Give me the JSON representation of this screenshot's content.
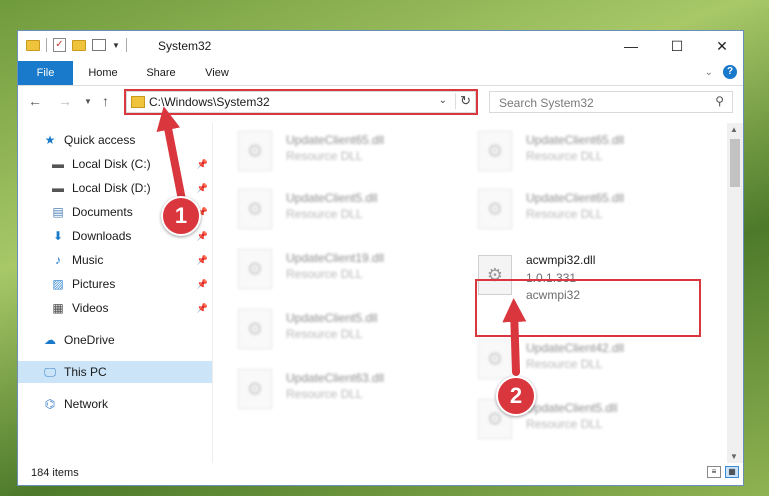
{
  "window": {
    "title": "System32",
    "controls": {
      "minimize": "—",
      "maximize": "☐",
      "close": "✕"
    }
  },
  "ribbon": {
    "tabs": [
      {
        "label": "File"
      },
      {
        "label": "Home"
      },
      {
        "label": "Share"
      },
      {
        "label": "View"
      }
    ],
    "help": "?"
  },
  "address_bar": {
    "path": "C:\\Windows\\System32",
    "refresh_icon": "refresh-icon"
  },
  "search": {
    "placeholder": "Search System32"
  },
  "sidebar": {
    "items": [
      {
        "label": "Quick access",
        "icon": "star-icon",
        "pinned": false
      },
      {
        "label": "Local Disk (C:)",
        "icon": "drive-icon",
        "pinned": true
      },
      {
        "label": "Local Disk (D:)",
        "icon": "drive-icon",
        "pinned": true
      },
      {
        "label": "Documents",
        "icon": "document-icon",
        "pinned": true
      },
      {
        "label": "Downloads",
        "icon": "download-icon",
        "pinned": true
      },
      {
        "label": "Music",
        "icon": "music-icon",
        "pinned": true
      },
      {
        "label": "Pictures",
        "icon": "pictures-icon",
        "pinned": true
      },
      {
        "label": "Videos",
        "icon": "video-icon",
        "pinned": true
      },
      {
        "label": "OneDrive",
        "icon": "cloud-icon",
        "pinned": false
      },
      {
        "label": "This PC",
        "icon": "computer-icon",
        "pinned": false,
        "selected": true
      },
      {
        "label": "Network",
        "icon": "network-icon",
        "pinned": false
      }
    ]
  },
  "files": {
    "left": [
      {
        "name": "UpdateClient65.dll",
        "type": "Resource DLL"
      },
      {
        "name": "UpdateClient5.dll",
        "type": "Resource DLL"
      },
      {
        "name": "UpdateClient19.dll",
        "type": "Resource DLL"
      },
      {
        "name": "UpdateClient5.dll",
        "type": "Resource DLL"
      },
      {
        "name": "UpdateClient63.dll",
        "type": "Resource DLL"
      }
    ],
    "right": [
      {
        "name": "UpdateClient65.dll",
        "type": "Resource DLL"
      },
      {
        "name": "UpdateClient65.dll",
        "type": "Resource DLL"
      },
      {
        "name": "acwmpi32.dll",
        "version": "1.0.1.331",
        "type": "acwmpi32",
        "highlighted": true
      },
      {
        "name": "UpdateClient42.dll",
        "type": "Resource DLL"
      },
      {
        "name": "UpdateClient5.dll",
        "type": "Resource DLL"
      }
    ]
  },
  "status": {
    "item_count": "184 items"
  },
  "annotations": {
    "step1": "1",
    "step2": "2",
    "accent": "#d9363e"
  }
}
